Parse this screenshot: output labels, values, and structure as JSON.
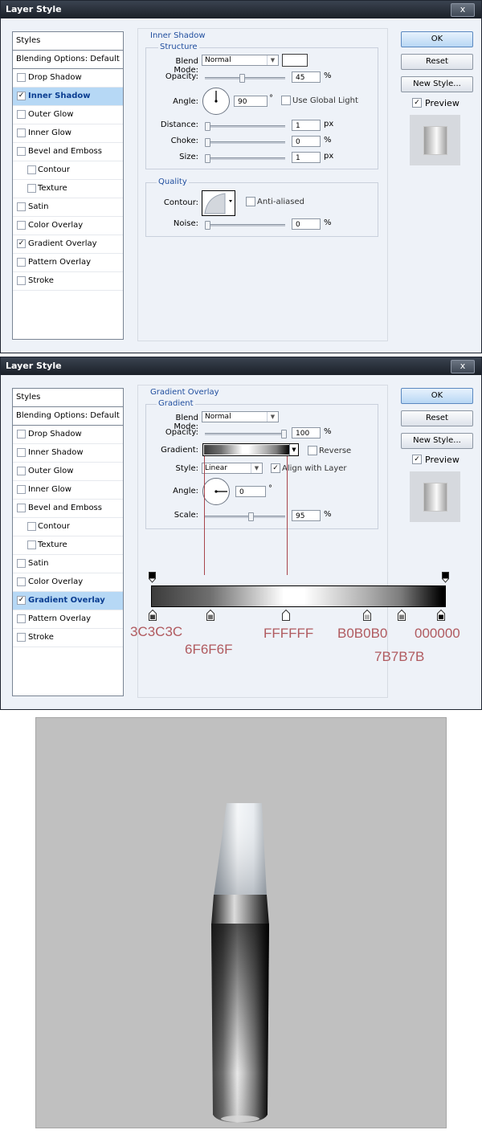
{
  "dialog1": {
    "title": "Layer Style",
    "close": "x",
    "styles": {
      "header": "Styles",
      "blending": "Blending Options: Default",
      "items": [
        {
          "label": "Drop Shadow",
          "checked": false,
          "indent": false,
          "selected": false
        },
        {
          "label": "Inner Shadow",
          "checked": true,
          "indent": false,
          "selected": true
        },
        {
          "label": "Outer Glow",
          "checked": false,
          "indent": false,
          "selected": false
        },
        {
          "label": "Inner Glow",
          "checked": false,
          "indent": false,
          "selected": false
        },
        {
          "label": "Bevel and Emboss",
          "checked": false,
          "indent": false,
          "selected": false
        },
        {
          "label": "Contour",
          "checked": false,
          "indent": true,
          "selected": false
        },
        {
          "label": "Texture",
          "checked": false,
          "indent": true,
          "selected": false
        },
        {
          "label": "Satin",
          "checked": false,
          "indent": false,
          "selected": false
        },
        {
          "label": "Color Overlay",
          "checked": false,
          "indent": false,
          "selected": false
        },
        {
          "label": "Gradient Overlay",
          "checked": true,
          "indent": false,
          "selected": false
        },
        {
          "label": "Pattern Overlay",
          "checked": false,
          "indent": false,
          "selected": false
        },
        {
          "label": "Stroke",
          "checked": false,
          "indent": false,
          "selected": false
        }
      ]
    },
    "section_title": "Inner Shadow",
    "structure": {
      "title": "Structure",
      "blend_mode_label": "Blend Mode:",
      "blend_mode_value": "Normal",
      "opacity_label": "Opacity:",
      "opacity_value": "45",
      "opacity_unit": "%",
      "opacity_level": 0.45,
      "angle_label": "Angle:",
      "angle_value": "90",
      "angle_unit": "°",
      "global_light_label": "Use Global Light",
      "distance_label": "Distance:",
      "distance_value": "1",
      "distance_unit": "px",
      "choke_label": "Choke:",
      "choke_value": "0",
      "choke_unit": "%",
      "size_label": "Size:",
      "size_value": "1",
      "size_unit": "px"
    },
    "quality": {
      "title": "Quality",
      "contour_label": "Contour:",
      "antialiased_label": "Anti-aliased",
      "noise_label": "Noise:",
      "noise_value": "0",
      "noise_unit": "%"
    },
    "buttons": {
      "ok": "OK",
      "reset": "Reset",
      "new_style": "New Style...",
      "preview": "Preview"
    }
  },
  "dialog2": {
    "title": "Layer Style",
    "close": "x",
    "styles": {
      "header": "Styles",
      "blending": "Blending Options: Default",
      "items": [
        {
          "label": "Drop Shadow",
          "checked": false,
          "indent": false,
          "selected": false
        },
        {
          "label": "Inner Shadow",
          "checked": false,
          "indent": false,
          "selected": false
        },
        {
          "label": "Outer Glow",
          "checked": false,
          "indent": false,
          "selected": false
        },
        {
          "label": "Inner Glow",
          "checked": false,
          "indent": false,
          "selected": false
        },
        {
          "label": "Bevel and Emboss",
          "checked": false,
          "indent": false,
          "selected": false
        },
        {
          "label": "Contour",
          "checked": false,
          "indent": true,
          "selected": false
        },
        {
          "label": "Texture",
          "checked": false,
          "indent": true,
          "selected": false
        },
        {
          "label": "Satin",
          "checked": false,
          "indent": false,
          "selected": false
        },
        {
          "label": "Color Overlay",
          "checked": false,
          "indent": false,
          "selected": false
        },
        {
          "label": "Gradient Overlay",
          "checked": true,
          "indent": false,
          "selected": true
        },
        {
          "label": "Pattern Overlay",
          "checked": false,
          "indent": false,
          "selected": false
        },
        {
          "label": "Stroke",
          "checked": false,
          "indent": false,
          "selected": false
        }
      ]
    },
    "section_title": "Gradient Overlay",
    "gradient": {
      "title": "Gradient",
      "blend_mode_label": "Blend Mode:",
      "blend_mode_value": "Normal",
      "opacity_label": "Opacity:",
      "opacity_value": "100",
      "opacity_unit": "%",
      "opacity_level": 1.0,
      "gradient_label": "Gradient:",
      "reverse_label": "Reverse",
      "style_label": "Style:",
      "style_value": "Linear",
      "align_label": "Align with Layer",
      "angle_label": "Angle:",
      "angle_value": "0",
      "angle_unit": "°",
      "scale_label": "Scale:",
      "scale_value": "95",
      "scale_unit": "%",
      "scale_level": 0.95
    },
    "buttons": {
      "ok": "OK",
      "reset": "Reset",
      "new_style": "New Style...",
      "preview": "Preview"
    }
  },
  "gradient_stops": {
    "s1": "3C3C3C",
    "s2": "6F6F6F",
    "s3": "FFFFFF",
    "s4": "B0B0B0",
    "s5": "7B7B7B",
    "s6": "000000"
  },
  "colors": {
    "accent": "#1f4d9e",
    "annotation": "#b05a5f",
    "selected_bg": "#b6d8f5",
    "scene_bg": "#c0c0c0"
  }
}
